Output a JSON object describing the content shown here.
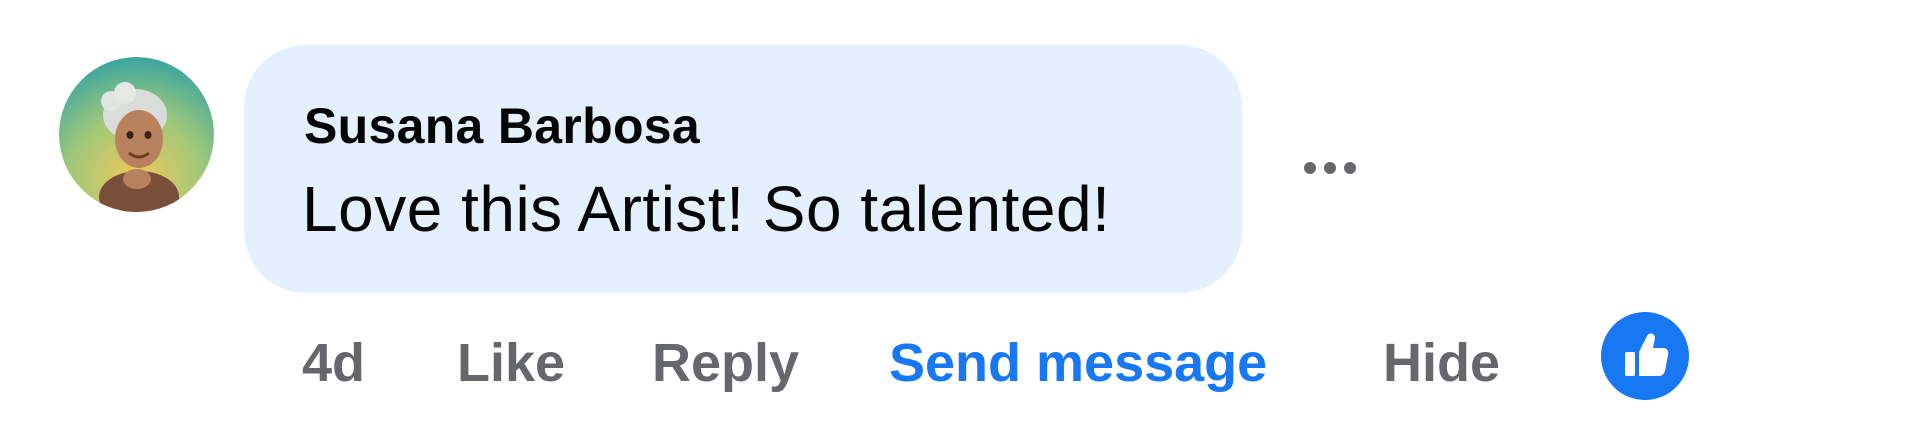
{
  "comment": {
    "author": "Susana Barbosa",
    "text": "Love this Artist! So talented!",
    "timestamp": "4d",
    "avatar_icon": "user-avatar-cartoon-woman"
  },
  "actions": {
    "like_label": "Like",
    "reply_label": "Reply",
    "send_message_label": "Send message",
    "hide_label": "Hide"
  },
  "icons": {
    "more_options": "ellipsis-icon",
    "reaction": "thumbs-up-icon"
  },
  "colors": {
    "bubble_background": "#e4f0fd",
    "accent": "#1877f2",
    "secondary_text": "#65676b",
    "primary_text": "#050505"
  }
}
